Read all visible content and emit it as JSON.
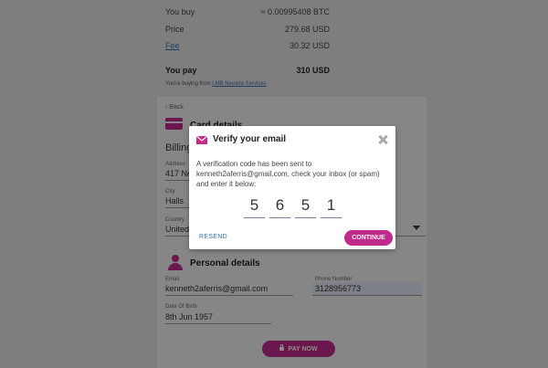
{
  "summary": {
    "rows": [
      {
        "label": "You buy",
        "value": "≈ 0.00995408 BTC"
      },
      {
        "label": "Price",
        "value": "279.68 USD"
      },
      {
        "label": "Fee",
        "value": "30.32 USD"
      },
      {
        "label": "You pay",
        "value": "310 USD"
      }
    ],
    "buying_from_prefix": "You're buying from",
    "buying_from_link": "LMB Nevada Services"
  },
  "card_details": {
    "back_label": "‹ Back",
    "title": "Card details",
    "billing_label": "Billing",
    "address_label": "Address",
    "address_value": "417 Ne",
    "city_label": "City",
    "city_value": "Halls",
    "country_label": "Country",
    "country_value": "United"
  },
  "personal_details": {
    "title": "Personal details",
    "email_label": "Email",
    "email_value": "kenneth2aferris@gmail.com",
    "phone_label": "Phone Number",
    "phone_value": "3128956773",
    "dob_label": "Date Of Birth",
    "dob_value": "8th Jun 1957"
  },
  "pay_button_label": "PAY NOW",
  "modal": {
    "title": "Verify your email",
    "message": "A verification code has been sent to kenneth2aferris@gmail.com, check your inbox (or spam) and enter it below:",
    "code": [
      "5",
      "6",
      "5",
      "1"
    ],
    "resend_label": "RESEND",
    "continue_label": "CONTINUE"
  },
  "colors": {
    "accent": "#c02a8b",
    "link": "#3a6fa8"
  },
  "icons": [
    "card-icon",
    "person-icon",
    "mail-icon",
    "close-icon",
    "lock-icon"
  ]
}
